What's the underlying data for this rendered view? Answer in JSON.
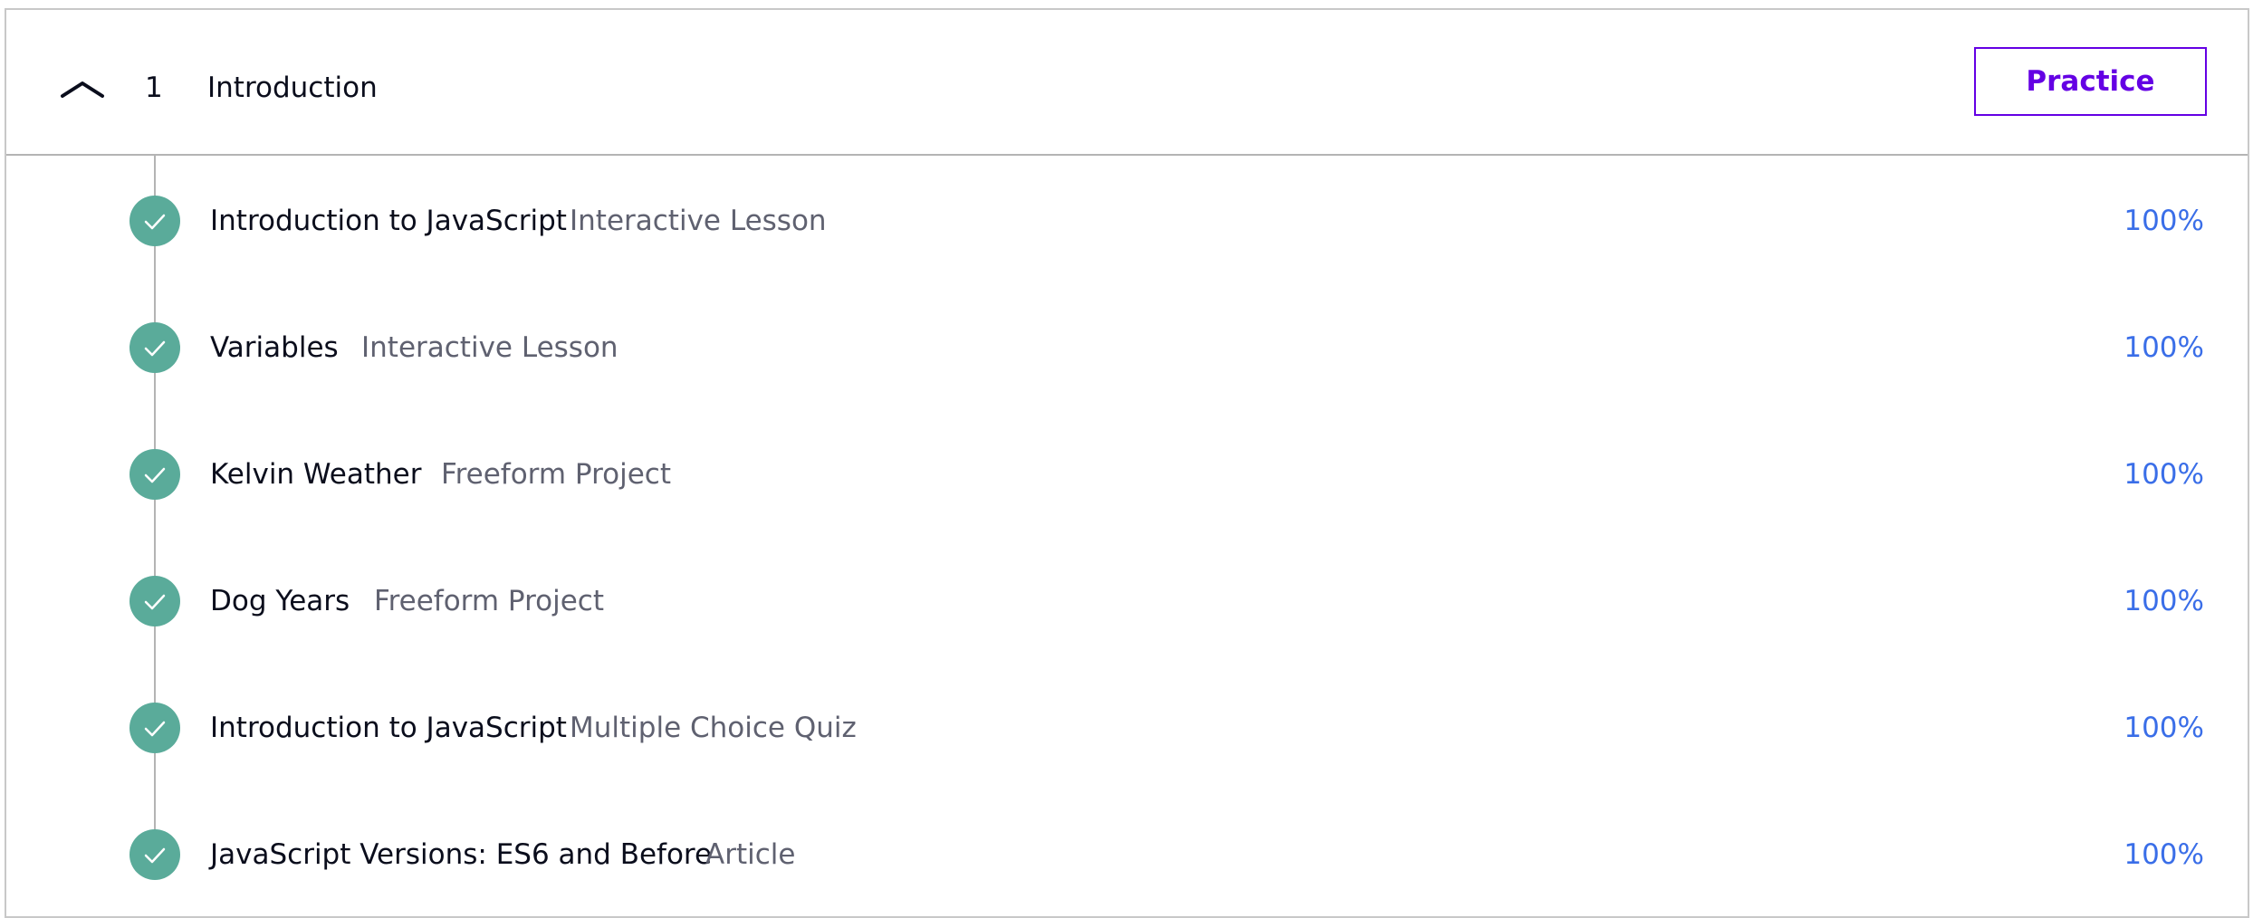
{
  "module": {
    "number": "1",
    "title": "Introduction",
    "toggle_icon": "chevron-up-icon",
    "practice_label": "Practice"
  },
  "lessons": [
    {
      "title": "Introduction to JavaScript",
      "type": "Interactive Lesson",
      "progress": "100%",
      "status_icon": "check-icon",
      "completed": true
    },
    {
      "title": "Variables",
      "type": "Interactive Lesson",
      "progress": "100%",
      "status_icon": "check-icon",
      "completed": true
    },
    {
      "title": "Kelvin Weather",
      "type": "Freeform Project",
      "progress": "100%",
      "status_icon": "check-icon",
      "completed": true
    },
    {
      "title": "Dog Years",
      "type": "Freeform Project",
      "progress": "100%",
      "status_icon": "check-icon",
      "completed": true
    },
    {
      "title": "Introduction to JavaScript",
      "type": "Multiple Choice Quiz",
      "progress": "100%",
      "status_icon": "check-icon",
      "completed": true
    },
    {
      "title": "JavaScript Versions: ES6 and Before",
      "type": "Article",
      "progress": "100%",
      "status_icon": "check-icon",
      "completed": true
    }
  ],
  "colors": {
    "accent_practice": "#6400e4",
    "progress_text": "#3a6ee8",
    "check_badge": "#5aab9a",
    "type_text": "#5f6170"
  }
}
